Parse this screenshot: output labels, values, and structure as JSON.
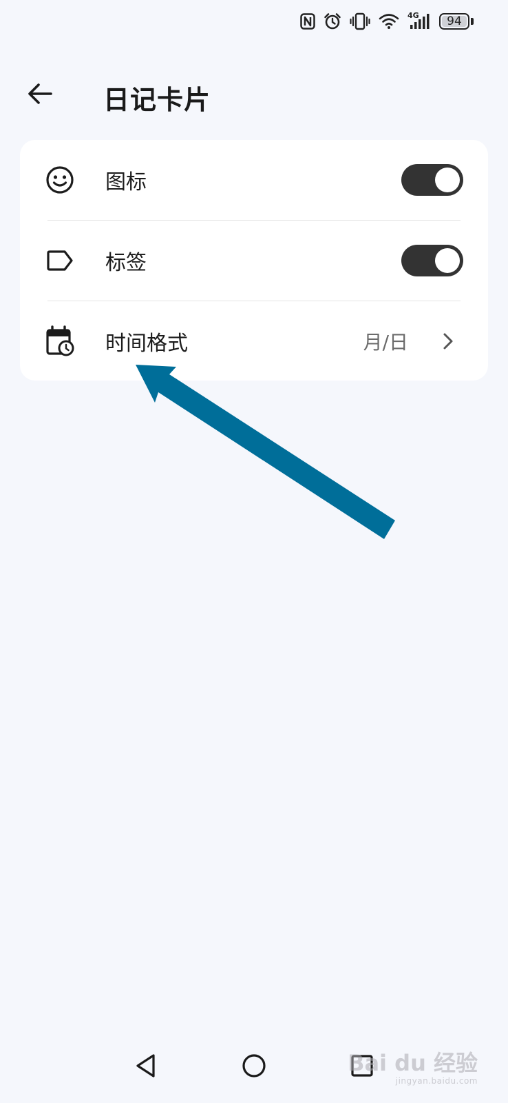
{
  "status_bar": {
    "battery_level": "94",
    "network_label": "4G",
    "icons": [
      "nfc-icon",
      "alarm-icon",
      "vibrate-icon",
      "wifi-icon",
      "signal-icon",
      "battery-icon"
    ]
  },
  "header": {
    "title": "日记卡片",
    "back_icon": "arrow-left-icon"
  },
  "settings": {
    "items": [
      {
        "label": "图标",
        "icon": "smiley-icon",
        "control": "toggle",
        "enabled": true
      },
      {
        "label": "标签",
        "icon": "tag-icon",
        "control": "toggle",
        "enabled": true
      },
      {
        "label": "时间格式",
        "icon": "calendar-clock-icon",
        "control": "link",
        "value": "月/日"
      }
    ]
  },
  "nav_bar": {
    "icons": [
      "back-triangle-icon",
      "home-circle-icon",
      "recents-square-icon"
    ]
  },
  "watermark": {
    "text": "Bai du 经验",
    "sub": "jingyan.baidu.com"
  },
  "colors": {
    "background": "#f5f7fc",
    "card": "#ffffff",
    "toggle_on": "#333333",
    "annotation_arrow": "#006e99"
  }
}
